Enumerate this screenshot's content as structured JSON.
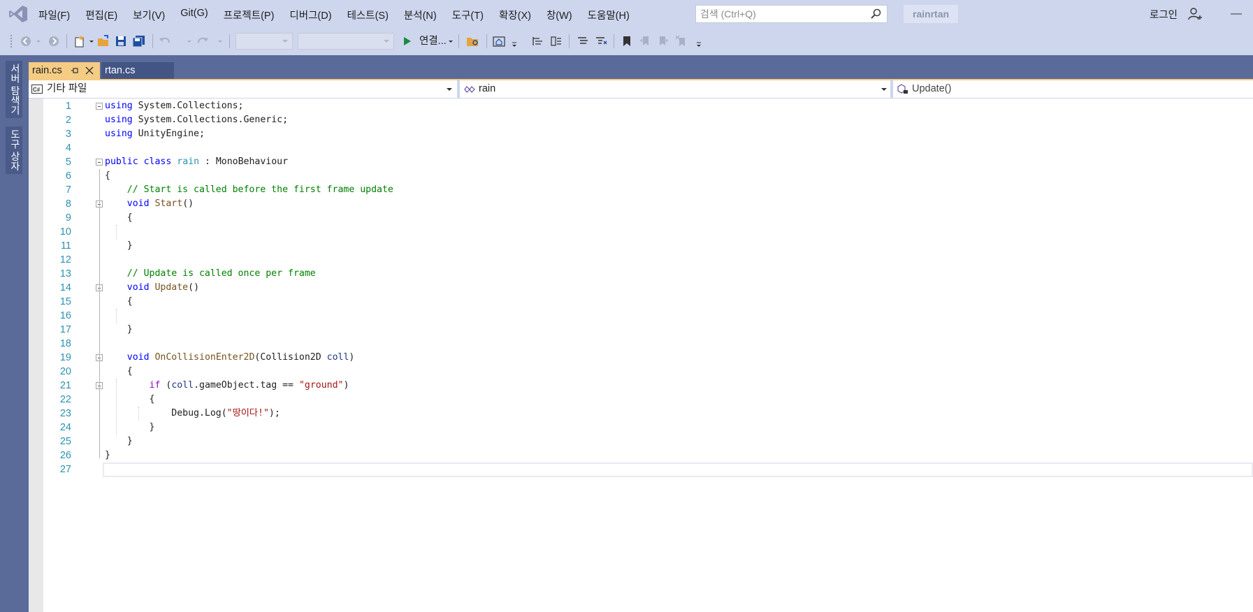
{
  "titlebar": {
    "menu": [
      "파일(F)",
      "편집(E)",
      "보기(V)",
      "Git(G)",
      "프로젝트(P)",
      "디버그(D)",
      "테스트(S)",
      "분석(N)",
      "도구(T)",
      "확장(X)",
      "창(W)",
      "도움말(H)"
    ],
    "search_placeholder": "검색 (Ctrl+Q)",
    "project_name": "rainrtan",
    "login_label": "로그인"
  },
  "toolbar": {
    "run_label": "연결..."
  },
  "side_tabs": [
    "서버 탐색기",
    "도구 상자"
  ],
  "tabs": [
    {
      "label": "rain.cs",
      "active": true
    },
    {
      "label": "rtan.cs",
      "active": false
    }
  ],
  "navbar": {
    "project": "기타 파일",
    "type": "rain",
    "member": "Update()"
  },
  "code": {
    "lines": [
      {
        "n": "1",
        "text": "using System.Collections;"
      },
      {
        "n": "2",
        "text": "using System.Collections.Generic;"
      },
      {
        "n": "3",
        "text": "using UnityEngine;"
      },
      {
        "n": "4",
        "text": ""
      },
      {
        "n": "5",
        "text": "public class rain : MonoBehaviour"
      },
      {
        "n": "6",
        "text": "{"
      },
      {
        "n": "7",
        "text": "    // Start is called before the first frame update"
      },
      {
        "n": "8",
        "text": "    void Start()"
      },
      {
        "n": "9",
        "text": "    {"
      },
      {
        "n": "10",
        "text": ""
      },
      {
        "n": "11",
        "text": "    }"
      },
      {
        "n": "12",
        "text": ""
      },
      {
        "n": "13",
        "text": "    // Update is called once per frame"
      },
      {
        "n": "14",
        "text": "    void Update()"
      },
      {
        "n": "15",
        "text": "    {"
      },
      {
        "n": "16",
        "text": ""
      },
      {
        "n": "17",
        "text": "    }"
      },
      {
        "n": "18",
        "text": ""
      },
      {
        "n": "19",
        "text": "    void OnCollisionEnter2D(Collision2D coll)"
      },
      {
        "n": "20",
        "text": "    {"
      },
      {
        "n": "21",
        "text": "        if (coll.gameObject.tag == \"ground\")"
      },
      {
        "n": "22",
        "text": "        {"
      },
      {
        "n": "23",
        "text": "            Debug.Log(\"땅이다!\");"
      },
      {
        "n": "24",
        "text": "        }"
      },
      {
        "n": "25",
        "text": "    }"
      },
      {
        "n": "26",
        "text": "}"
      },
      {
        "n": "27",
        "text": ""
      }
    ],
    "fold_lines": [
      1,
      5,
      8,
      14,
      19,
      21
    ],
    "current_line": 27
  }
}
